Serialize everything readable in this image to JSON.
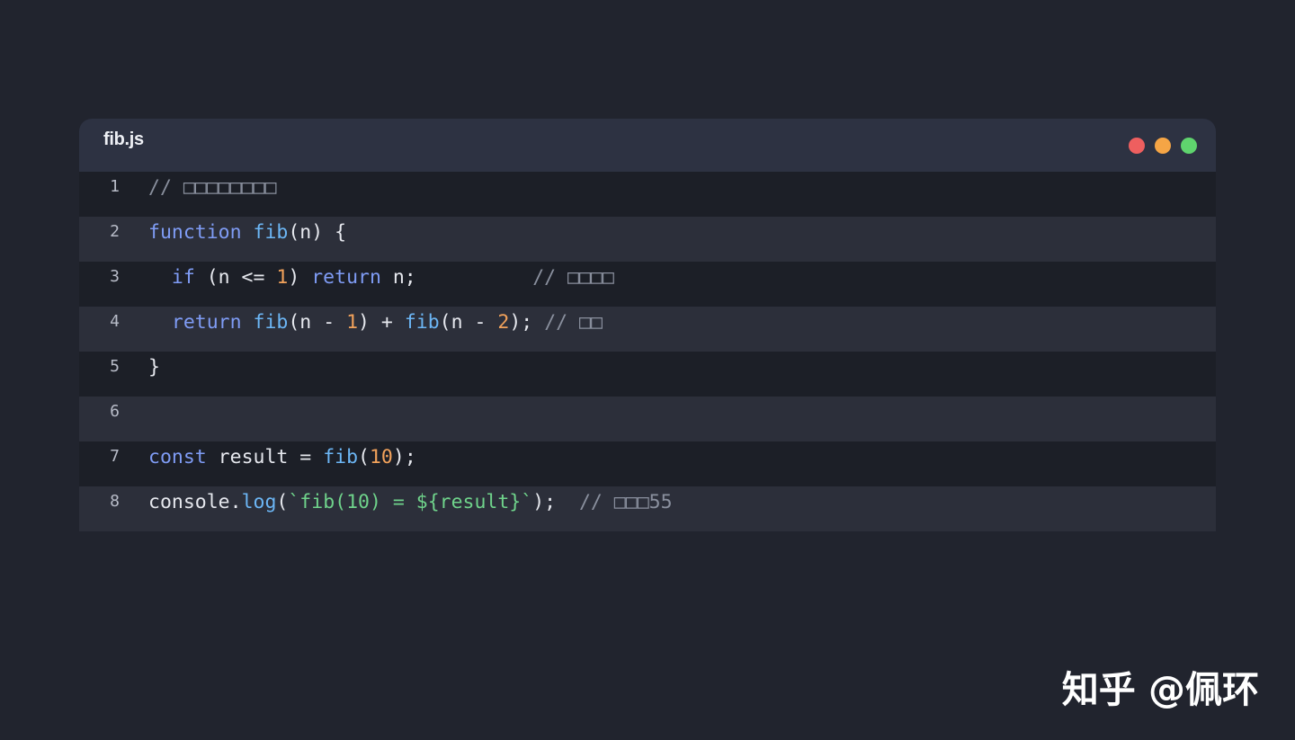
{
  "editor": {
    "filename": "fib.js",
    "window_controls": [
      {
        "name": "close",
        "color": "#ee5f5f"
      },
      {
        "name": "minimize",
        "color": "#f5a545"
      },
      {
        "name": "maximize",
        "color": "#5fd46e"
      }
    ],
    "lines": [
      {
        "number": "1",
        "tokens": [
          {
            "t": "cm",
            "v": "// □□□□□□□□"
          }
        ]
      },
      {
        "number": "2",
        "tokens": [
          {
            "t": "kw",
            "v": "function"
          },
          {
            "t": "",
            "v": " "
          },
          {
            "t": "fn",
            "v": "fib"
          },
          {
            "t": "",
            "v": "(n) {"
          }
        ]
      },
      {
        "number": "3",
        "tokens": [
          {
            "t": "",
            "v": "  "
          },
          {
            "t": "kw",
            "v": "if"
          },
          {
            "t": "",
            "v": " (n <= "
          },
          {
            "t": "num",
            "v": "1"
          },
          {
            "t": "",
            "v": ") "
          },
          {
            "t": "kw",
            "v": "return"
          },
          {
            "t": "",
            "v": " n;          "
          },
          {
            "t": "cm",
            "v": "// □□□□"
          }
        ]
      },
      {
        "number": "4",
        "tokens": [
          {
            "t": "",
            "v": "  "
          },
          {
            "t": "kw",
            "v": "return"
          },
          {
            "t": "",
            "v": " "
          },
          {
            "t": "fn",
            "v": "fib"
          },
          {
            "t": "",
            "v": "(n - "
          },
          {
            "t": "num",
            "v": "1"
          },
          {
            "t": "",
            "v": ") + "
          },
          {
            "t": "fn",
            "v": "fib"
          },
          {
            "t": "",
            "v": "(n - "
          },
          {
            "t": "num",
            "v": "2"
          },
          {
            "t": "",
            "v": "); "
          },
          {
            "t": "cm",
            "v": "// □□"
          }
        ]
      },
      {
        "number": "5",
        "tokens": [
          {
            "t": "",
            "v": "}"
          }
        ]
      },
      {
        "number": "6",
        "tokens": []
      },
      {
        "number": "7",
        "tokens": [
          {
            "t": "kw",
            "v": "const"
          },
          {
            "t": "",
            "v": " result = "
          },
          {
            "t": "fn",
            "v": "fib"
          },
          {
            "t": "",
            "v": "("
          },
          {
            "t": "num",
            "v": "10"
          },
          {
            "t": "",
            "v": ");"
          }
        ]
      },
      {
        "number": "8",
        "tokens": [
          {
            "t": "",
            "v": "console."
          },
          {
            "t": "fn",
            "v": "log"
          },
          {
            "t": "",
            "v": "("
          },
          {
            "t": "str",
            "v": "`fib(10) = ${result}`"
          },
          {
            "t": "",
            "v": ");  "
          },
          {
            "t": "cm",
            "v": "// □□□55"
          }
        ]
      }
    ]
  },
  "watermark": "知乎 @佩环"
}
